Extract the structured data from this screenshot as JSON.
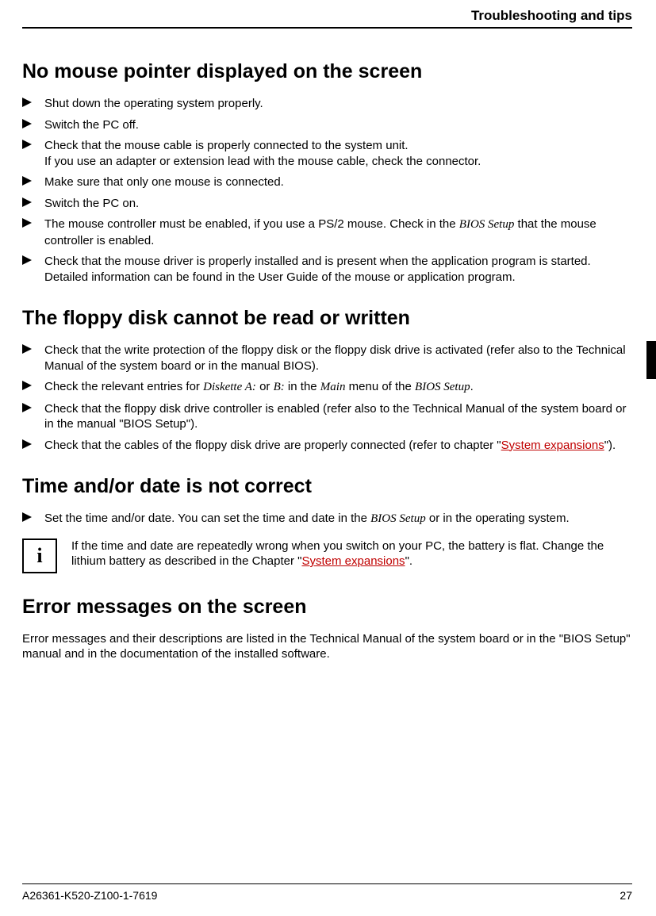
{
  "header": {
    "title": "Troubleshooting and tips"
  },
  "side_tab": {
    "present": true
  },
  "sections": {
    "s1": {
      "heading": "No mouse pointer displayed on the screen",
      "items": {
        "i0": {
          "text": "Shut down the operating system properly."
        },
        "i1": {
          "text": "Switch the PC off."
        },
        "i2": {
          "line1": "Check that the mouse cable is properly connected to the system unit.",
          "line2": "If you use an adapter or extension lead with the mouse cable, check the connector."
        },
        "i3": {
          "text": "Make sure that only one mouse is connected."
        },
        "i4": {
          "text": "Switch the PC on."
        },
        "i5": {
          "pre": "The mouse controller must be enabled, if you use a PS/2 mouse. Check in the ",
          "ital": "BIOS Setup",
          "post": " that the mouse controller is enabled."
        },
        "i6": {
          "text": "Check that the mouse driver is properly installed and is present when the application program is started. Detailed information can be found in the User Guide of the mouse or application program."
        }
      }
    },
    "s2": {
      "heading": "The floppy disk cannot be read or written",
      "items": {
        "i0": {
          "text": "Check that the write protection of the floppy disk or the floppy disk drive is activated (refer also to the Technical Manual of the system board or in the manual BIOS)."
        },
        "i1": {
          "p0": "Check the relevant entries for ",
          "ital0": "Diskette A:",
          "p1": " or ",
          "ital1": "B:",
          "p2": " in the ",
          "ital2": "Main",
          "p3": " menu of the ",
          "ital3": "BIOS Setup",
          "p4": "."
        },
        "i2": {
          "text": "Check that the floppy disk drive controller is enabled (refer also to the Technical Manual of the system board or in the manual \"BIOS Setup\")."
        },
        "i3": {
          "pre": "Check that the cables of the floppy disk drive are properly connected (refer to chapter \"",
          "link": "System expansions",
          "post": "\")."
        }
      }
    },
    "s3": {
      "heading": "Time and/or date is not correct",
      "items": {
        "i0": {
          "pre": "Set the time and/or date. You can set the time and date in the ",
          "ital": "BIOS Setup",
          "post": " or in the operating system."
        }
      },
      "info": {
        "icon": "i",
        "pre": "If the time and date are repeatedly wrong when you switch on your PC, the battery is flat. Change the lithium battery as described in the Chapter \"",
        "link": "System expansions",
        "post": "\"."
      }
    },
    "s4": {
      "heading": "Error messages on the screen",
      "body": "Error messages and their descriptions are listed in the Technical Manual of the system board or in the \"BIOS Setup\" manual and in the documentation of the installed software."
    }
  },
  "footer": {
    "left": "A26361-K520-Z100-1-7619",
    "right": "27"
  }
}
